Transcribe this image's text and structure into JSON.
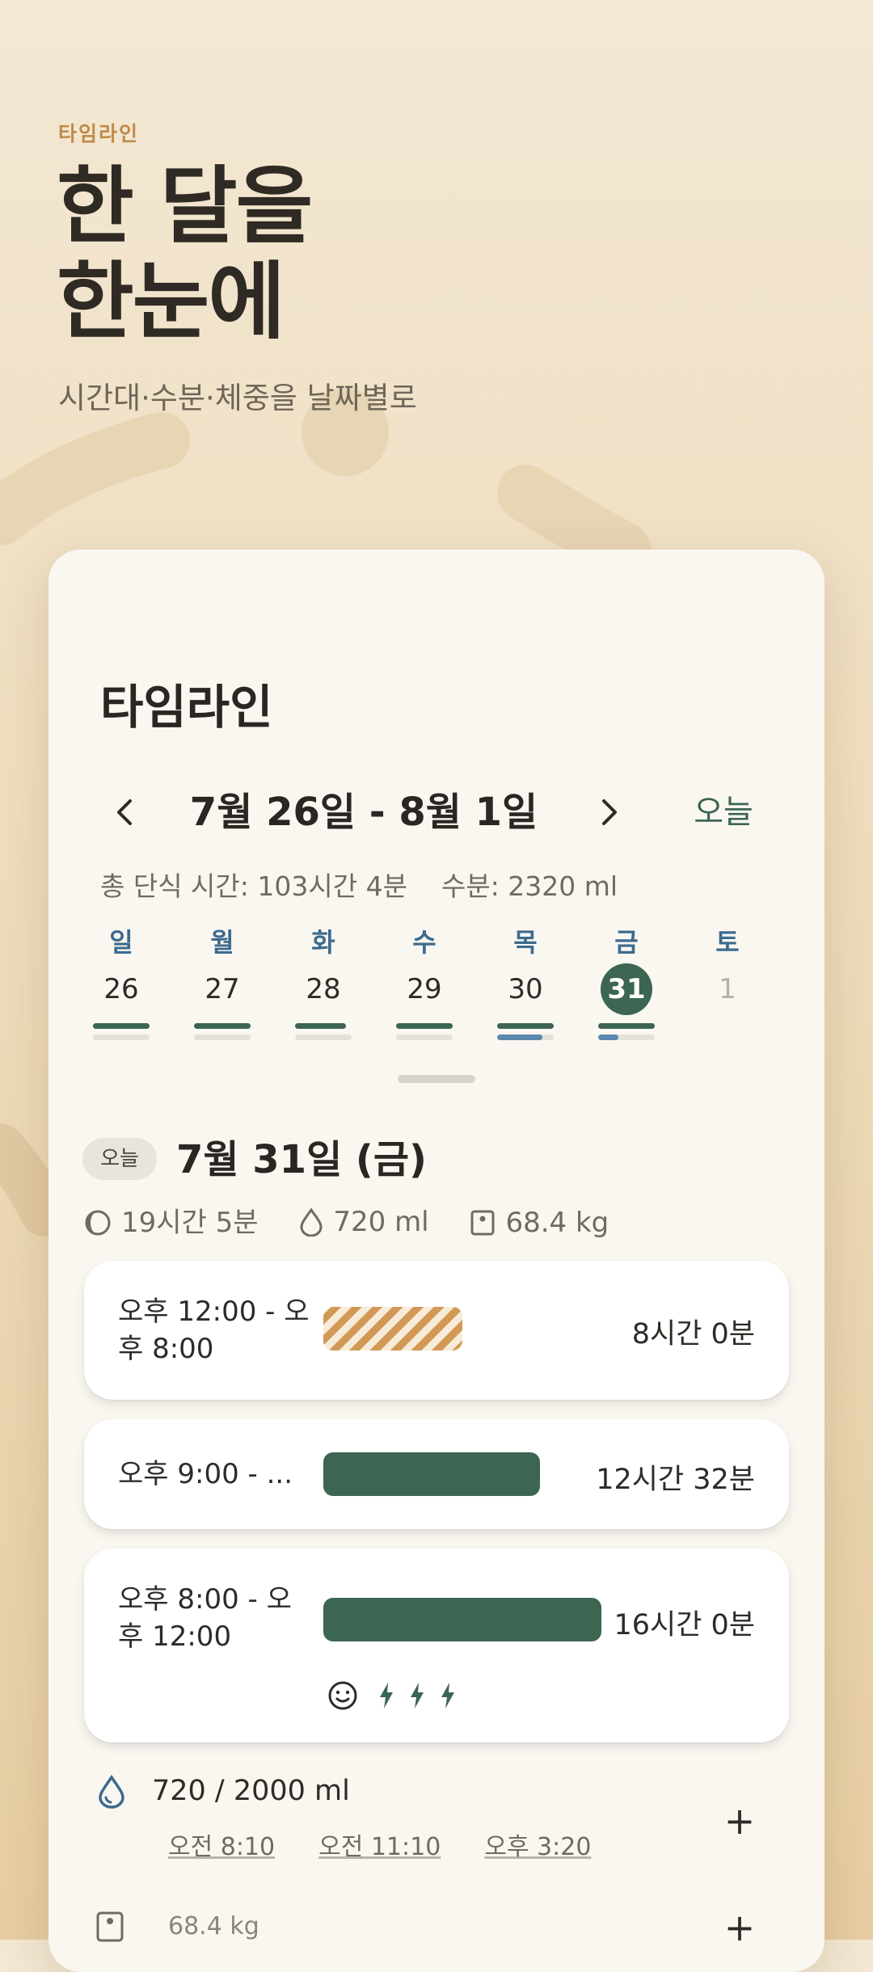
{
  "hero": {
    "eyebrow": "타임라인",
    "title_line1": "한 달을",
    "title_line2": "한눈에",
    "subtitle": "시간대·수분·체중을 날짜별로"
  },
  "screen": {
    "title": "타임라인",
    "nav": {
      "prev_icon": "chevron-left",
      "next_icon": "chevron-right",
      "range": "7월 26일 - 8월 1일",
      "today_label": "오늘"
    },
    "summary": {
      "fasting_total": "총 단식 시간: 103시간 4분",
      "water_total": "수분: 2320 ml"
    },
    "week": [
      {
        "dow": "일",
        "num": "26",
        "fast_level": 1.0,
        "water_level": 0.0,
        "selected": false,
        "dim": false
      },
      {
        "dow": "월",
        "num": "27",
        "fast_level": 1.0,
        "water_level": 0.0,
        "selected": false,
        "dim": false
      },
      {
        "dow": "화",
        "num": "28",
        "fast_level": 0.9,
        "water_level": 0.0,
        "selected": false,
        "dim": false
      },
      {
        "dow": "수",
        "num": "29",
        "fast_level": 1.0,
        "water_level": 0.0,
        "selected": false,
        "dim": false
      },
      {
        "dow": "목",
        "num": "30",
        "fast_level": 1.0,
        "water_level": 0.8,
        "selected": false,
        "dim": false
      },
      {
        "dow": "금",
        "num": "31",
        "fast_level": 1.0,
        "water_level": 0.36,
        "selected": true,
        "dim": false
      },
      {
        "dow": "토",
        "num": "1",
        "fast_level": 0.0,
        "water_level": 0.0,
        "selected": false,
        "dim": true
      }
    ],
    "day": {
      "today_chip": "오늘",
      "heading": "7월 31일 (금)",
      "stats": {
        "fasting": "19시간 5분",
        "water": "720 ml",
        "weight": "68.4 kg"
      },
      "entries": [
        {
          "time": "오후 12:00 - 오후 8:00",
          "duration": "8시간 0분",
          "style": "hatched",
          "bar_fraction": 0.5
        },
        {
          "time": "오후 9:00 - ...",
          "duration": "12시간 32분",
          "style": "solid",
          "bar_fraction": 0.78
        },
        {
          "time": "오후 8:00 - 오후 12:00",
          "duration": "16시간 0분",
          "style": "solid",
          "bar_fraction": 1.0,
          "mood_icon": "smile-icon",
          "energy_level": 3
        }
      ],
      "water": {
        "amount": "720 / 2000 ml",
        "times": [
          "오전 8:10",
          "오전 11:10",
          "오후 3:20"
        ],
        "add_label": "+"
      },
      "weight": {
        "value": "68.4 kg",
        "add_label": "+"
      }
    }
  },
  "colors": {
    "accent_green": "#3c6552",
    "accent_blue": "#3d6b8e",
    "hatch_orange": "#d29855",
    "eyebrow_orange": "#c08a4a"
  }
}
